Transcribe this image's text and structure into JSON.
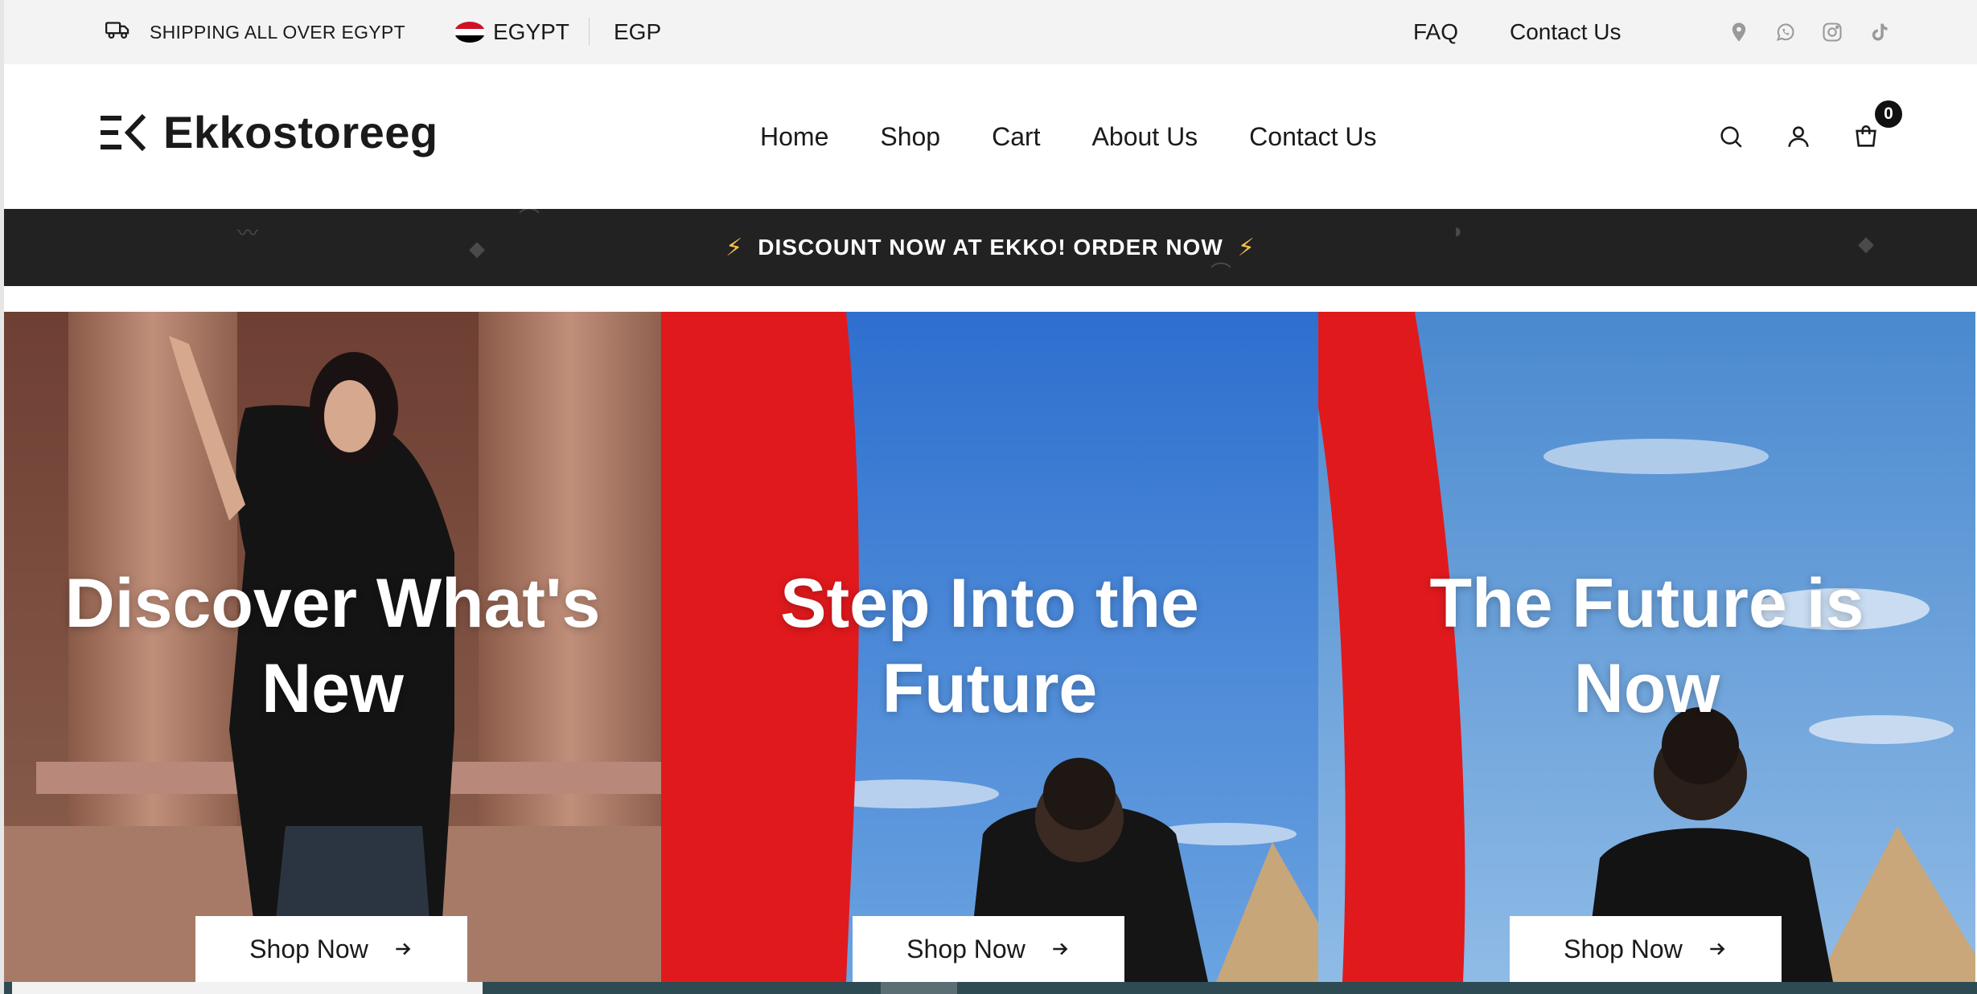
{
  "topbar": {
    "shipping_text": "SHIPPING ALL OVER EGYPT",
    "country": "EGYPT",
    "currency": "EGP",
    "links": [
      "FAQ",
      "Contact Us"
    ],
    "socials": [
      "location-pin-icon",
      "whatsapp-icon",
      "instagram-icon",
      "tiktok-icon"
    ]
  },
  "header": {
    "logo_text": "Ekkostoreeg",
    "nav": [
      "Home",
      "Shop",
      "Cart",
      "About Us",
      "Contact Us"
    ],
    "cart_count": "0"
  },
  "announcement": {
    "text": "DISCOUNT NOW AT EKKO! ORDER NOW"
  },
  "hero": {
    "panels": [
      {
        "title": "Discover What's New",
        "button": "Shop Now"
      },
      {
        "title": "Step Into the Future",
        "button": "Shop Now"
      },
      {
        "title": "The Future is Now",
        "button": "Shop Now"
      }
    ]
  },
  "colors": {
    "topbar_bg": "#f3f3f3",
    "announce_bg": "#222222",
    "bolt": "#f6c24a",
    "flag_red": "#ce1126",
    "flag_black": "#000000"
  }
}
